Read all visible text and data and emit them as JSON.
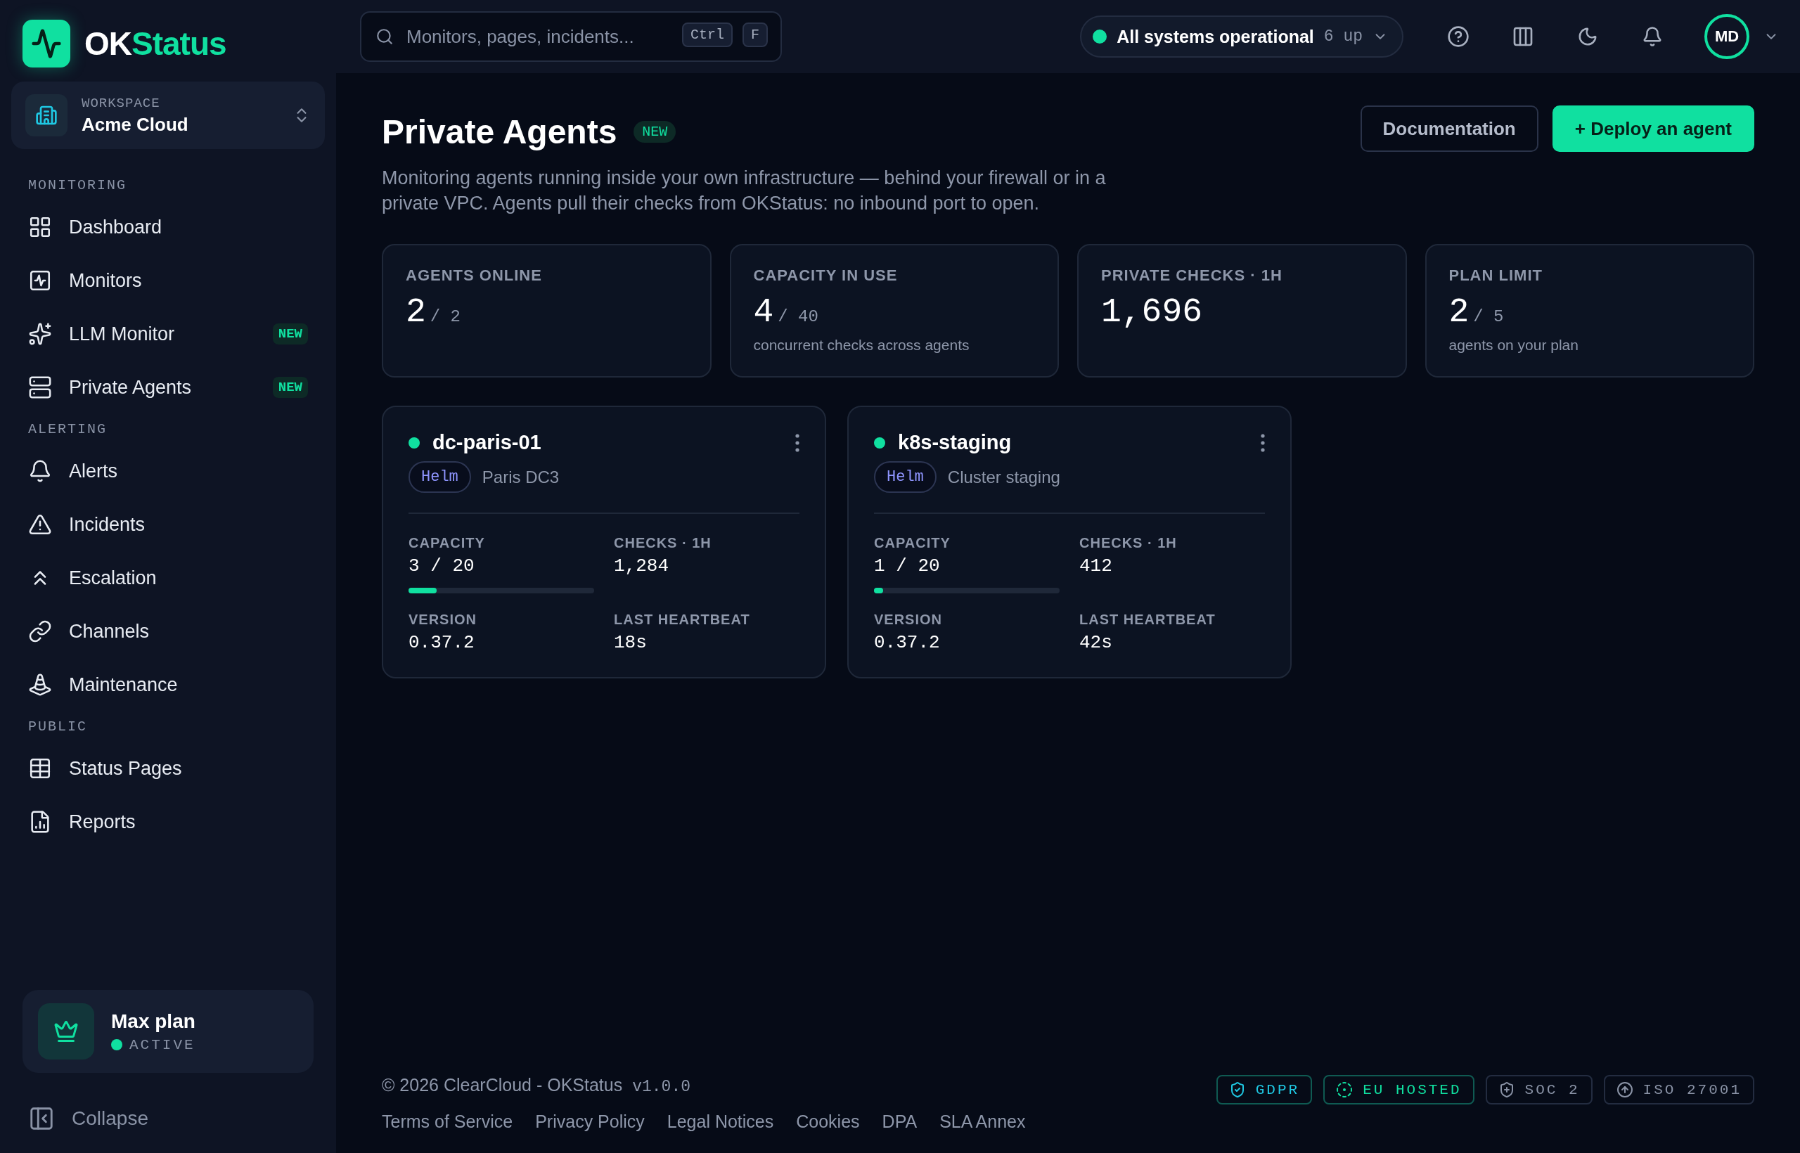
{
  "brand": {
    "prefix": "OK",
    "suffix": "Status"
  },
  "workspace": {
    "label": "WORKSPACE",
    "name": "Acme Cloud"
  },
  "nav_sections": [
    {
      "title": "MONITORING",
      "items": [
        {
          "label": "Dashboard"
        },
        {
          "label": "Monitors"
        },
        {
          "label": "LLM Monitor",
          "badge": "NEW"
        },
        {
          "label": "Private Agents",
          "badge": "NEW"
        }
      ]
    },
    {
      "title": "ALERTING",
      "items": [
        {
          "label": "Alerts"
        },
        {
          "label": "Incidents"
        },
        {
          "label": "Escalation"
        },
        {
          "label": "Channels"
        },
        {
          "label": "Maintenance"
        }
      ]
    },
    {
      "title": "PUBLIC",
      "items": [
        {
          "label": "Status Pages"
        },
        {
          "label": "Reports"
        }
      ]
    }
  ],
  "plan": {
    "name": "Max plan",
    "status": "ACTIVE",
    "active": true
  },
  "collapse": "Collapse",
  "search": {
    "placeholder": "Monitors, pages, incidents...",
    "keys": [
      "Ctrl",
      "F"
    ]
  },
  "system_status": {
    "label": "All systems operational",
    "count": "6 up",
    "ok": true
  },
  "avatar": "MD",
  "page": {
    "title": "Private Agents",
    "badge": "NEW",
    "description": "Monitoring agents running inside your own infrastructure — behind your firewall or in a private VPC. Agents pull their checks from OKStatus: no inbound port to open.",
    "buttons": [
      {
        "label": "Documentation",
        "kind": "secondary"
      },
      {
        "label": "+ Deploy an agent",
        "kind": "primary"
      }
    ]
  },
  "stats": [
    {
      "label": "AGENTS ONLINE",
      "value": "2",
      "total": "/ 2"
    },
    {
      "label": "CAPACITY IN USE",
      "value": "4",
      "total": "/ 40",
      "note": "concurrent checks across agents"
    },
    {
      "label": "PRIVATE CHECKS · 1H",
      "value": "1,696"
    },
    {
      "label": "PLAN LIMIT",
      "value": "2",
      "total": "/ 5",
      "note": "agents on your plan"
    }
  ],
  "agents": [
    {
      "name": "dc-paris-01",
      "online": true,
      "tag": "Helm",
      "location": "Paris DC3",
      "capacity_label": "CAPACITY",
      "capacity": "3 / 20",
      "level": 0.15,
      "checks_label": "CHECKS · 1H",
      "checks": "1,284",
      "version_label": "VERSION",
      "version": "0.37.2",
      "heartbeat_label": "LAST HEARTBEAT",
      "heartbeat": "18s"
    },
    {
      "name": "k8s-staging",
      "online": true,
      "tag": "Helm",
      "location": "Cluster staging",
      "capacity_label": "CAPACITY",
      "capacity": "1 / 20",
      "level": 0.05,
      "checks_label": "CHECKS · 1H",
      "checks": "412",
      "version_label": "VERSION",
      "version": "0.37.2",
      "heartbeat_label": "LAST HEARTBEAT",
      "heartbeat": "42s"
    }
  ],
  "footer": {
    "copyright": "© 2026 ClearCloud - OKStatus",
    "version": "v1.0.0",
    "links": [
      "Terms of Service",
      "Privacy Policy",
      "Legal Notices",
      "Cookies",
      "DPA",
      "SLA Annex"
    ],
    "badges": [
      {
        "label": "GDPR",
        "color": "#1fc8e3"
      },
      {
        "label": "EU HOSTED",
        "color": "#10e0a0"
      },
      {
        "label": "SOC 2",
        "color": "#8a93a6"
      },
      {
        "label": "ISO 27001",
        "color": "#8a93a6"
      }
    ]
  }
}
